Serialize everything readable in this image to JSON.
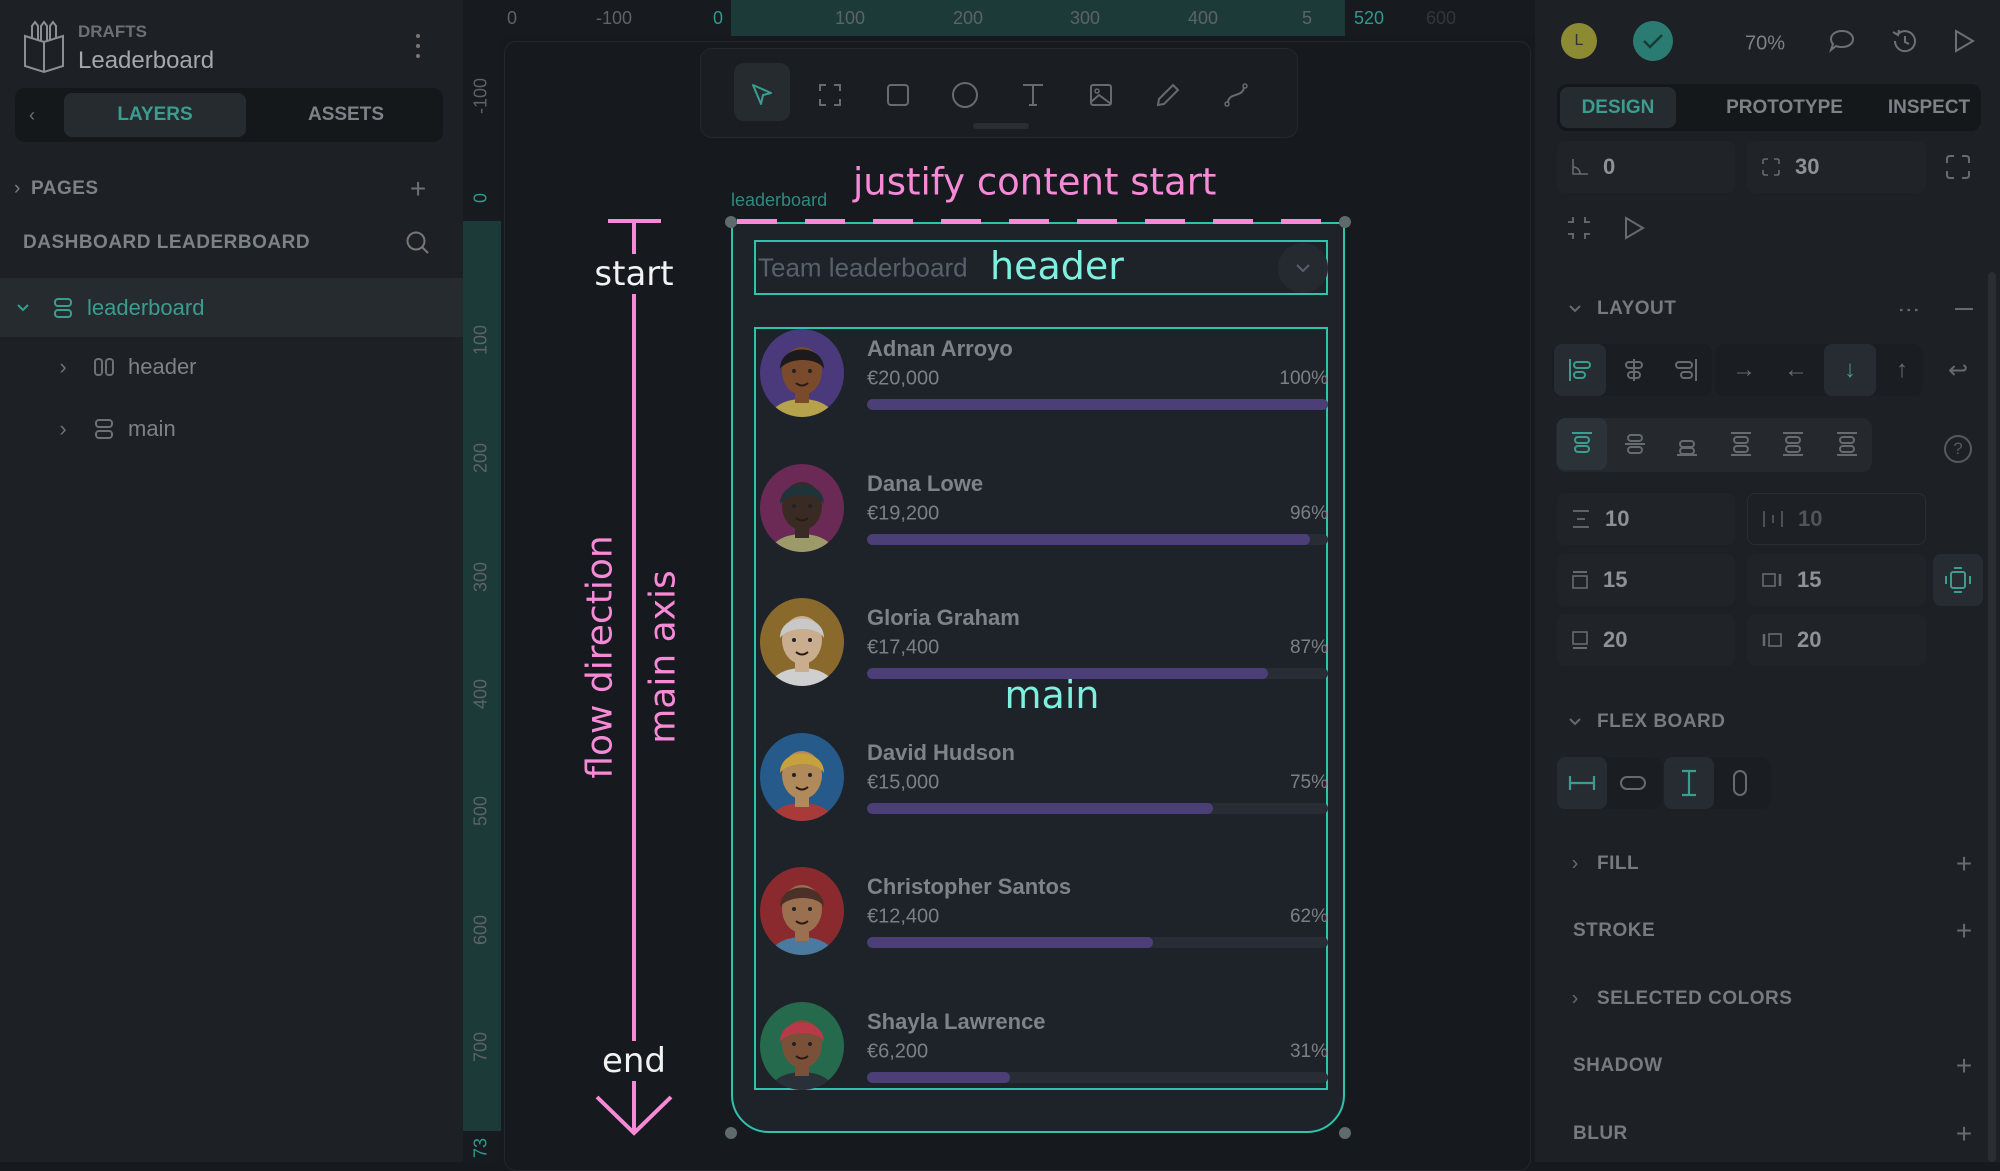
{
  "project": {
    "section": "DRAFTS",
    "title": "Leaderboard"
  },
  "left_tabs": {
    "layers": "LAYERS",
    "assets": "ASSETS"
  },
  "pages_label": "PAGES",
  "page_name": "DASHBOARD LEADERBOARD",
  "layers": [
    {
      "name": "leaderboard",
      "selected": true,
      "expanded": true
    },
    {
      "name": "header",
      "selected": false,
      "expanded": false
    },
    {
      "name": "main",
      "selected": false,
      "expanded": false
    }
  ],
  "ruler_top": [
    "0",
    "-100",
    "0",
    "100",
    "200",
    "300",
    "400",
    "5",
    "520",
    "600"
  ],
  "ruler_left": [
    "-100",
    "0",
    "100",
    "200",
    "300",
    "400",
    "500",
    "600",
    "700",
    "73"
  ],
  "toolbar": [
    "move-icon",
    "board-icon",
    "rectangle-icon",
    "ellipse-icon",
    "text-icon",
    "image-icon",
    "pencil-icon",
    "path-icon"
  ],
  "board": {
    "label": "leaderboard",
    "header_title": "Team leaderboard",
    "rows": [
      {
        "name": "Adnan Arroyo",
        "amount": "€20,000",
        "pct_label": "100%",
        "pct": 100,
        "bg": "#4a3a7c",
        "skin": "#7a4a2c",
        "hair": "#1b1b1e",
        "shirt": "#b6a24a"
      },
      {
        "name": "Dana Lowe",
        "amount": "€19,200",
        "pct_label": "96%",
        "pct": 96,
        "bg": "#6a2a55",
        "skin": "#3a2a24",
        "hair": "#1e343a",
        "shirt": "#9d9a6a"
      },
      {
        "name": "Gloria Graham",
        "amount": "€17,400",
        "pct_label": "87%",
        "pct": 87,
        "bg": "#8a6a2c",
        "skin": "#c9ad8e",
        "hair": "#c8c8c8",
        "shirt": "#cfcfcf"
      },
      {
        "name": "David Hudson",
        "amount": "€15,000",
        "pct_label": "75%",
        "pct": 75,
        "bg": "#265a8a",
        "skin": "#b08a5a",
        "hair": "#c7a23c",
        "shirt": "#a83a3a"
      },
      {
        "name": "Christopher Santos",
        "amount": "€12,400",
        "pct_label": "62%",
        "pct": 62,
        "bg": "#8a2a2e",
        "skin": "#9a7050",
        "hair": "#4a3026",
        "shirt": "#4a7aa0"
      },
      {
        "name": "Shayla Lawrence",
        "amount": "€6,200",
        "pct_label": "31%",
        "pct": 31,
        "bg": "#256a4c",
        "skin": "#7a5038",
        "hair": "#b83a48",
        "shirt": "#2a3038"
      }
    ]
  },
  "annotations": {
    "justify": "justify content start",
    "header": "header",
    "main": "main",
    "start": "start",
    "end": "end",
    "flow_direction": "flow direction",
    "main_axis": "main axis"
  },
  "topbar": {
    "user_initial": "L",
    "zoom": "70%"
  },
  "right_tabs": {
    "design": "DESIGN",
    "prototype": "PROTOTYPE",
    "inspect": "INSPECT"
  },
  "design": {
    "rotation": "0",
    "radius": "30",
    "layout_label": "LAYOUT",
    "row_gap": "10",
    "column_gap": "10",
    "padding_top": "15",
    "padding_right": "15",
    "padding_bottom": "20",
    "padding_left": "20",
    "flex_board_label": "FLEX BOARD",
    "fill_label": "FILL",
    "stroke_label": "STROKE",
    "selected_colors_label": "SELECTED COLORS",
    "shadow_label": "SHADOW",
    "blur_label": "BLUR",
    "direction_active": "column",
    "justify_active": "start"
  },
  "colors": {
    "accent": "#31c4b0",
    "annotation": "#f78ad6",
    "bar": "#4c3f78"
  }
}
